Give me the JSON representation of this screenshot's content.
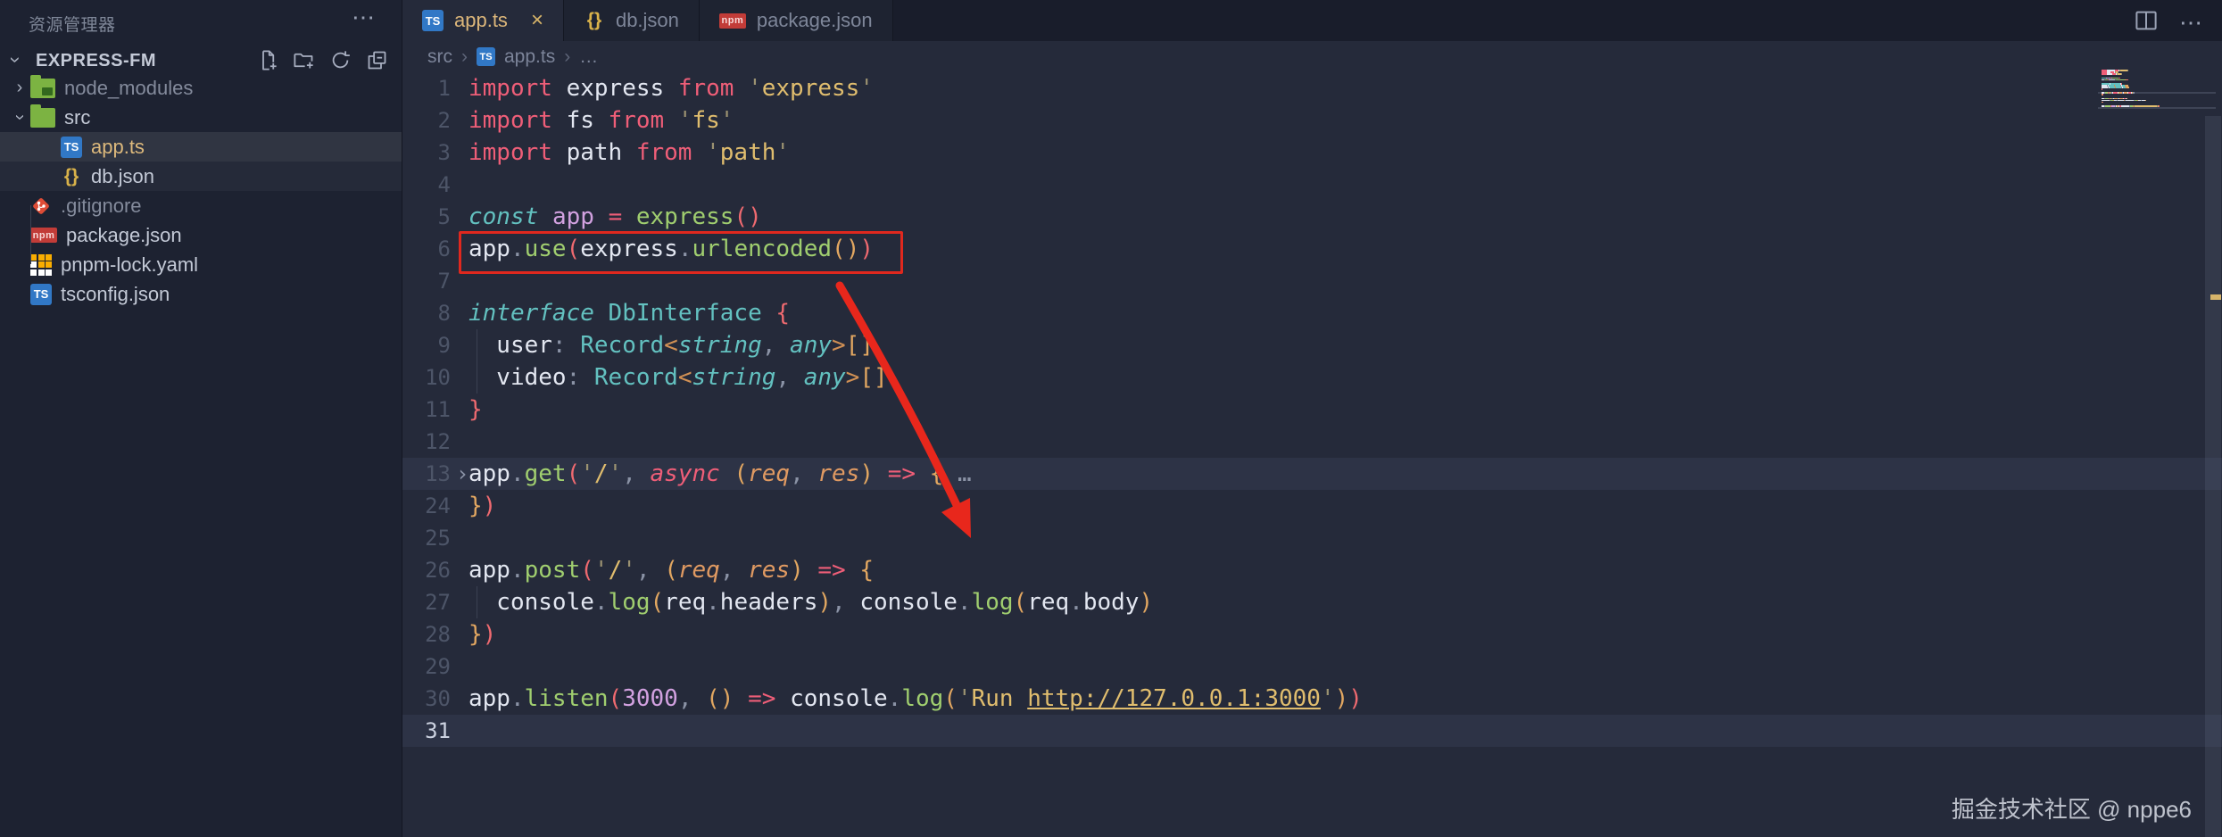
{
  "colors": {
    "syntax": {
      "k": "#ef5e78",
      "ki": "#ef5e78",
      "s": "#e0bd6e",
      "su": "#e0bd6e",
      "q": "#9b9271",
      "w": "#e3e7f1",
      "d": "#8b93a6",
      "f": "#a0ce6f",
      "t": "#63c1c0",
      "ti": "#63c1c0",
      "v": "#d2a1e0",
      "n": "#d2a1e0",
      "p": "#e09a62",
      "o": "#d19054",
      "b1": "#ef6a70",
      "b2": "#e2a761"
    },
    "annotation_red": "#e0281e",
    "active_tab_accent": "#d8b569",
    "modified_file": "#ddb97c",
    "ts_icon_blue": "#3178c6",
    "npm_red": "#c23c38",
    "folder_green": "#7cb342",
    "pnpm_gold": "#f9ad00"
  },
  "explorer": {
    "title": "资源管理器",
    "more": "⋯",
    "section": "EXPRESS-FM",
    "section_chevron": "›",
    "toolbar": [
      "new-file",
      "new-folder",
      "refresh",
      "collapse-all"
    ],
    "items": [
      {
        "label": "node_modules",
        "icon": "folder-npm",
        "depth": 1,
        "chevron": "›",
        "dim": true
      },
      {
        "label": "src",
        "icon": "folder-src",
        "depth": 1,
        "chevron": "⌄",
        "expanded": true
      },
      {
        "label": "app.ts",
        "icon": "ts",
        "depth": 2,
        "selected": true,
        "modified": true
      },
      {
        "label": "db.json",
        "icon": "braces",
        "depth": 2,
        "subtle": true
      },
      {
        "label": ".gitignore",
        "icon": "git",
        "depth": 1,
        "dim": true
      },
      {
        "label": "package.json",
        "icon": "npm",
        "depth": 1
      },
      {
        "label": "pnpm-lock.yaml",
        "icon": "pnpm",
        "depth": 1
      },
      {
        "label": "tsconfig.json",
        "icon": "ts-gear",
        "depth": 1
      }
    ]
  },
  "tabs": [
    {
      "label": "app.ts",
      "icon": "ts",
      "active": true,
      "close": "×"
    },
    {
      "label": "db.json",
      "icon": "braces",
      "active": false
    },
    {
      "label": "package.json",
      "icon": "npm",
      "active": false
    }
  ],
  "editor_actions": {
    "more": "⋯"
  },
  "breadcrumb": {
    "sep": "›",
    "items": [
      {
        "label": "src"
      },
      {
        "label": "app.ts",
        "icon": "ts"
      },
      {
        "label": "…"
      }
    ]
  },
  "code": {
    "lines": [
      {
        "num": "1",
        "tokens": [
          [
            "import",
            "k"
          ],
          [
            " express ",
            "w"
          ],
          [
            "from",
            "k"
          ],
          [
            " ",
            "w"
          ],
          [
            "'",
            "q"
          ],
          [
            "express",
            "s"
          ],
          [
            "'",
            "q"
          ]
        ]
      },
      {
        "num": "2",
        "tokens": [
          [
            "import",
            "k"
          ],
          [
            " fs ",
            "w"
          ],
          [
            "from",
            "k"
          ],
          [
            " ",
            "w"
          ],
          [
            "'",
            "q"
          ],
          [
            "fs",
            "s"
          ],
          [
            "'",
            "q"
          ]
        ]
      },
      {
        "num": "3",
        "tokens": [
          [
            "import",
            "k"
          ],
          [
            " path ",
            "w"
          ],
          [
            "from",
            "k"
          ],
          [
            " ",
            "w"
          ],
          [
            "'",
            "q"
          ],
          [
            "path",
            "s"
          ],
          [
            "'",
            "q"
          ]
        ]
      },
      {
        "num": "4",
        "tokens": []
      },
      {
        "num": "5",
        "tokens": [
          [
            "const",
            "ti"
          ],
          [
            " ",
            "w"
          ],
          [
            "app",
            "v"
          ],
          [
            " ",
            "w"
          ],
          [
            "=",
            "k"
          ],
          [
            " ",
            "w"
          ],
          [
            "express",
            "f"
          ],
          [
            "(",
            "b1"
          ],
          [
            ")",
            "b1"
          ]
        ]
      },
      {
        "num": "6",
        "tokens": [
          [
            "app",
            "w"
          ],
          [
            ".",
            "d"
          ],
          [
            "use",
            "f"
          ],
          [
            "(",
            "b1"
          ],
          [
            "express",
            "w"
          ],
          [
            ".",
            "d"
          ],
          [
            "urlencoded",
            "f"
          ],
          [
            "(",
            "b2"
          ],
          [
            ")",
            "b2"
          ],
          [
            ")",
            "b1"
          ]
        ]
      },
      {
        "num": "7",
        "tokens": []
      },
      {
        "num": "8",
        "tokens": [
          [
            "interface",
            "ti"
          ],
          [
            " ",
            "w"
          ],
          [
            "DbInterface",
            "t"
          ],
          [
            " ",
            "w"
          ],
          [
            "{",
            "b1"
          ]
        ]
      },
      {
        "num": "9",
        "tokens": [
          [
            "  user",
            "w"
          ],
          [
            ":",
            "d"
          ],
          [
            " ",
            "w"
          ],
          [
            "Record",
            "t"
          ],
          [
            "<",
            "o"
          ],
          [
            "string",
            "ti"
          ],
          [
            ",",
            "d"
          ],
          [
            " ",
            "w"
          ],
          [
            "any",
            "ti"
          ],
          [
            ">",
            "o"
          ],
          [
            "[]",
            "b2"
          ]
        ]
      },
      {
        "num": "10",
        "tokens": [
          [
            "  video",
            "w"
          ],
          [
            ":",
            "d"
          ],
          [
            " ",
            "w"
          ],
          [
            "Record",
            "t"
          ],
          [
            "<",
            "o"
          ],
          [
            "string",
            "ti"
          ],
          [
            ",",
            "d"
          ],
          [
            " ",
            "w"
          ],
          [
            "any",
            "ti"
          ],
          [
            ">",
            "o"
          ],
          [
            "[]",
            "b2"
          ]
        ]
      },
      {
        "num": "11",
        "tokens": [
          [
            "}",
            "b1"
          ]
        ]
      },
      {
        "num": "12",
        "tokens": []
      },
      {
        "num": "13",
        "folded": true,
        "highlighted": true,
        "fold_chevron": "›",
        "tokens": [
          [
            "app",
            "w"
          ],
          [
            ".",
            "d"
          ],
          [
            "get",
            "f"
          ],
          [
            "(",
            "b1"
          ],
          [
            "'",
            "q"
          ],
          [
            "/",
            "s"
          ],
          [
            "'",
            "q"
          ],
          [
            ",",
            "d"
          ],
          [
            " ",
            "w"
          ],
          [
            "async",
            "ki"
          ],
          [
            " ",
            "w"
          ],
          [
            "(",
            "b2"
          ],
          [
            "req",
            "p"
          ],
          [
            ",",
            "d"
          ],
          [
            " ",
            "w"
          ],
          [
            "res",
            "p"
          ],
          [
            ")",
            "b2"
          ],
          [
            " ",
            "w"
          ],
          [
            "=>",
            "k"
          ],
          [
            " ",
            "w"
          ],
          [
            "{",
            "b2"
          ],
          [
            " …",
            "d"
          ]
        ]
      },
      {
        "num": "24",
        "tokens": [
          [
            "}",
            "b2"
          ],
          [
            ")",
            "b1"
          ]
        ]
      },
      {
        "num": "25",
        "tokens": []
      },
      {
        "num": "26",
        "tokens": [
          [
            "app",
            "w"
          ],
          [
            ".",
            "d"
          ],
          [
            "post",
            "f"
          ],
          [
            "(",
            "b1"
          ],
          [
            "'",
            "q"
          ],
          [
            "/",
            "s"
          ],
          [
            "'",
            "q"
          ],
          [
            ",",
            "d"
          ],
          [
            " ",
            "w"
          ],
          [
            "(",
            "b2"
          ],
          [
            "req",
            "p"
          ],
          [
            ",",
            "d"
          ],
          [
            " ",
            "w"
          ],
          [
            "res",
            "p"
          ],
          [
            ")",
            "b2"
          ],
          [
            " ",
            "w"
          ],
          [
            "=>",
            "k"
          ],
          [
            " ",
            "w"
          ],
          [
            "{",
            "b2"
          ]
        ]
      },
      {
        "num": "27",
        "tokens": [
          [
            "  console",
            "w"
          ],
          [
            ".",
            "d"
          ],
          [
            "log",
            "f"
          ],
          [
            "(",
            "b2"
          ],
          [
            "req",
            "w"
          ],
          [
            ".",
            "d"
          ],
          [
            "headers",
            "w"
          ],
          [
            ")",
            "b2"
          ],
          [
            ",",
            "d"
          ],
          [
            " ",
            "w"
          ],
          [
            "console",
            "w"
          ],
          [
            ".",
            "d"
          ],
          [
            "log",
            "f"
          ],
          [
            "(",
            "b2"
          ],
          [
            "req",
            "w"
          ],
          [
            ".",
            "d"
          ],
          [
            "body",
            "w"
          ],
          [
            ")",
            "b2"
          ]
        ]
      },
      {
        "num": "28",
        "tokens": [
          [
            "}",
            "b2"
          ],
          [
            ")",
            "b1"
          ]
        ]
      },
      {
        "num": "29",
        "tokens": []
      },
      {
        "num": "30",
        "tokens": [
          [
            "app",
            "w"
          ],
          [
            ".",
            "d"
          ],
          [
            "listen",
            "f"
          ],
          [
            "(",
            "b1"
          ],
          [
            "3000",
            "n"
          ],
          [
            ",",
            "d"
          ],
          [
            " ",
            "w"
          ],
          [
            "(",
            "b2"
          ],
          [
            ")",
            "b2"
          ],
          [
            " ",
            "w"
          ],
          [
            "=>",
            "k"
          ],
          [
            " ",
            "w"
          ],
          [
            "console",
            "w"
          ],
          [
            ".",
            "d"
          ],
          [
            "log",
            "f"
          ],
          [
            "(",
            "b2"
          ],
          [
            "'",
            "q"
          ],
          [
            "Run ",
            "s"
          ],
          [
            "http://127.0.0.1:3000",
            "su"
          ],
          [
            "'",
            "q"
          ],
          [
            ")",
            "b2"
          ],
          [
            ")",
            "b1"
          ]
        ]
      },
      {
        "num": "31",
        "current": true,
        "highlighted": true,
        "tokens": []
      }
    ]
  },
  "watermark": "掘金技术社区 @ nppe6"
}
